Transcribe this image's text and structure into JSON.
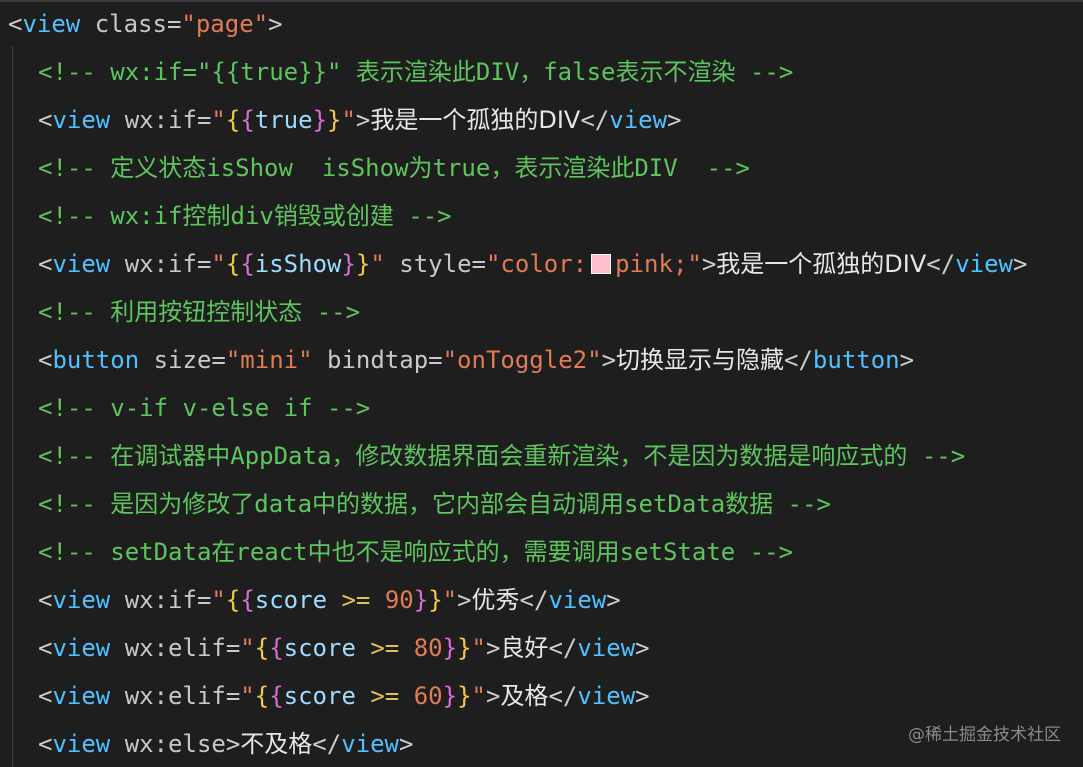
{
  "editor": {
    "line1": {
      "open": "<",
      "tag": "view",
      "attr": " class=",
      "value": "\"page\"",
      "close": ">"
    },
    "line2": {
      "text": "<!-- wx:if=\"{{true}}\" 表示渲染此DIV，false表示不渲染 -->"
    },
    "line3": {
      "open": "<",
      "tag": "view",
      "attr": " wx:if=",
      "q1": "\"",
      "b1": "{",
      "b2": "{",
      "expr": "true",
      "b3": "}",
      "b4": "}",
      "q2": "\"",
      "close": ">",
      "text": "我是一个孤独的DIV",
      "end_open": "</",
      "end_tag": "view",
      "end_close": ">"
    },
    "line4": {
      "text": "<!-- 定义状态isShow  isShow为true，表示渲染此DIV  -->"
    },
    "line5": {
      "text": "<!-- wx:if控制div销毁或创建 -->"
    },
    "line6": {
      "open": "<",
      "tag": "view",
      "attr": " wx:if=",
      "q1": "\"",
      "b1": "{",
      "b2": "{",
      "expr": "isShow",
      "b3": "}",
      "b4": "}",
      "q2": "\"",
      "attr2": " style=",
      "style_q1": "\"color:",
      "swatch_color": "#ffc0cb",
      "style_value": "pink;\"",
      "close": ">",
      "text": "我是一个孤独的DIV",
      "end_open": "</",
      "end_tag": "view",
      "end_close": ">"
    },
    "line7": {
      "text": "<!-- 利用按钮控制状态 -->"
    },
    "line8": {
      "open": "<",
      "tag": "button",
      "attr": " size=",
      "value": "\"mini\"",
      "attr2": " bindtap=",
      "value2": "\"onToggle2\"",
      "close": ">",
      "text": "切换显示与隐藏",
      "end_open": "</",
      "end_tag": "button",
      "end_close": ">"
    },
    "line9": {
      "text": "<!-- v-if v-else if -->"
    },
    "line10": {
      "text": "<!-- 在调试器中AppData，修改数据界面会重新渲染，不是因为数据是响应式的 -->"
    },
    "line11": {
      "text": "<!-- 是因为修改了data中的数据，它内部会自动调用setData数据 -->"
    },
    "line12": {
      "text": "<!-- setData在react中也不是响应式的，需要调用setState -->"
    },
    "line13": {
      "open": "<",
      "tag": "view",
      "attr": " wx:if=",
      "q1": "\"",
      "b1": "{",
      "b2": "{",
      "expr": "score ",
      "op": ">=",
      "num": " 90",
      "b3": "}",
      "b4": "}",
      "q2": "\"",
      "close": ">",
      "text": "优秀",
      "end_open": "</",
      "end_tag": "view",
      "end_close": ">"
    },
    "line14": {
      "open": "<",
      "tag": "view",
      "attr": " wx:elif=",
      "q1": "\"",
      "b1": "{",
      "b2": "{",
      "expr": "score ",
      "op": ">=",
      "num": " 80",
      "b3": "}",
      "b4": "}",
      "q2": "\"",
      "close": ">",
      "text": "良好",
      "end_open": "</",
      "end_tag": "view",
      "end_close": ">"
    },
    "line15": {
      "open": "<",
      "tag": "view",
      "attr": " wx:elif=",
      "q1": "\"",
      "b1": "{",
      "b2": "{",
      "expr": "score ",
      "op": ">=",
      "num": " 60",
      "b3": "}",
      "b4": "}",
      "q2": "\"",
      "close": ">",
      "text": "及格",
      "end_open": "</",
      "end_tag": "view",
      "end_close": ">"
    },
    "line16": {
      "open": "<",
      "tag": "view",
      "attr": " wx:else",
      "close": ">",
      "text": "不及格",
      "end_open": "</",
      "end_tag": "view",
      "end_close": ">"
    }
  },
  "watermark": "@稀土掘金技术社区",
  "colors": {
    "background": "#1e1e1e",
    "tag": "#4fc1ff",
    "string": "#e07b53",
    "comment": "#5ec45e",
    "brace_outer": "#f2c94c",
    "brace_inner": "#d76ed8"
  }
}
